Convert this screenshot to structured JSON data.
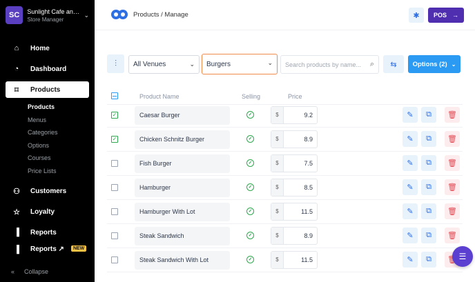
{
  "store": {
    "initials": "SC",
    "name": "Sunlight Cafe and Bar",
    "role": "Store Manager"
  },
  "nav": {
    "home": "Home",
    "dashboard": "Dashboard",
    "products": "Products",
    "products_sub": [
      "Products",
      "Menus",
      "Categories",
      "Options",
      "Courses",
      "Price Lists"
    ],
    "customers": "Customers",
    "loyalty": "Loyalty",
    "reports": "Reports",
    "reports_new": "Reports ↗",
    "new_badge": "NEW",
    "collapse": "Collapse"
  },
  "header": {
    "breadcrumb": "Products / Manage",
    "pos_label": "POS"
  },
  "filters": {
    "venue": "All Venues",
    "category": "Burgers",
    "search_placeholder": "Search products by name...",
    "options_label": "Options (2)"
  },
  "table": {
    "headers": {
      "name": "Product Name",
      "selling": "Selling",
      "price": "Price"
    },
    "currency": "$",
    "rows": [
      {
        "name": "Caesar Burger",
        "price": "9.2",
        "checked": true
      },
      {
        "name": "Chicken Schnitz Burger",
        "price": "8.9",
        "checked": true
      },
      {
        "name": "Fish Burger",
        "price": "7.5",
        "checked": false
      },
      {
        "name": "Hamburger",
        "price": "8.5",
        "checked": false
      },
      {
        "name": "Hamburger With Lot",
        "price": "11.5",
        "checked": false
      },
      {
        "name": "Steak Sandwich",
        "price": "8.9",
        "checked": false
      },
      {
        "name": "Steak Sandwich With Lot",
        "price": "11.5",
        "checked": false
      }
    ]
  },
  "colors": {
    "accent": "#2b9af3",
    "brand": "#4f2fb0",
    "success": "#2fa84f",
    "danger": "#e14b55",
    "highlight": "#f08a4b"
  }
}
